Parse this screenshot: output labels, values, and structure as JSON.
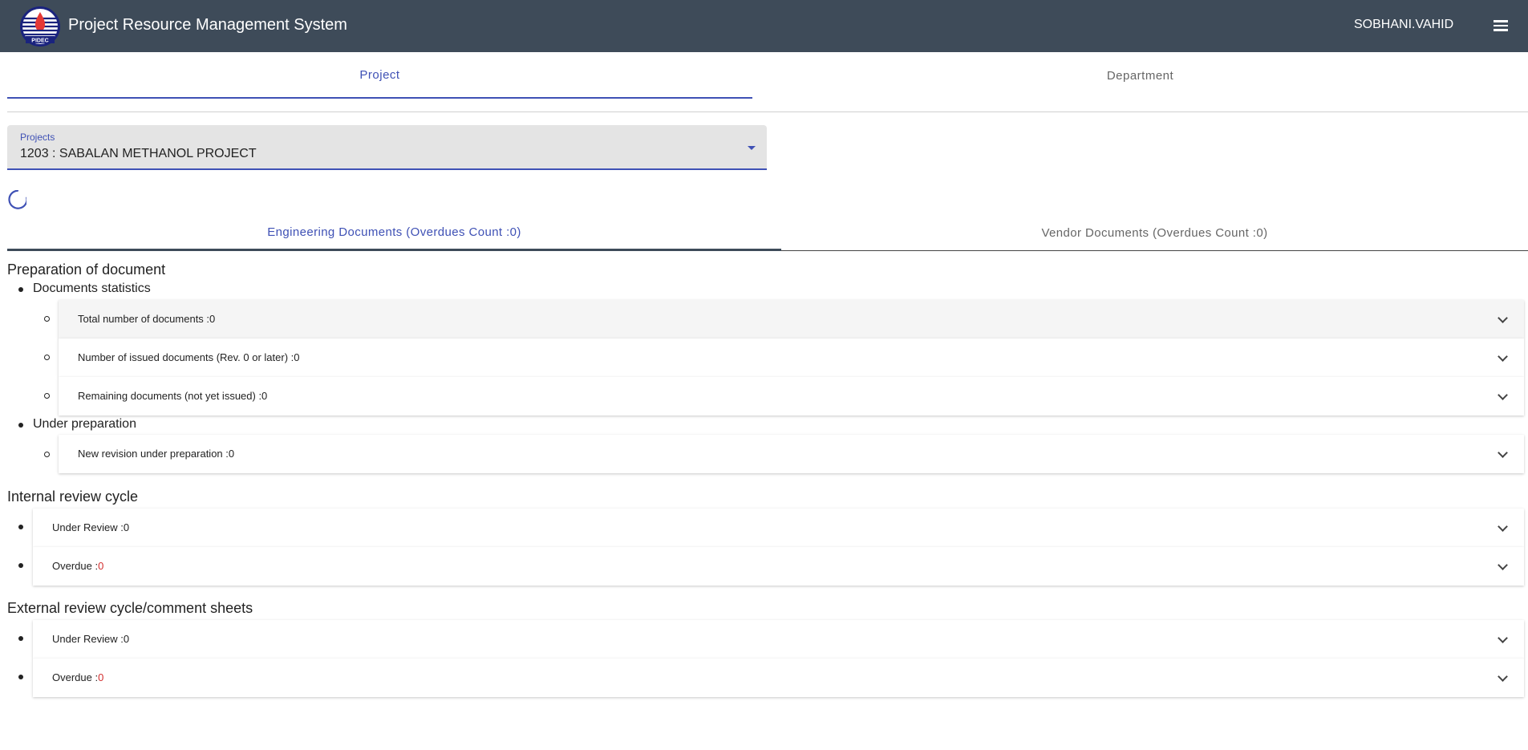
{
  "header": {
    "logo_text": "PIDEC",
    "title": "Project Resource Management System",
    "user": "SOBHANI.VAHID",
    "menu_icon": "hamburger-menu-icon"
  },
  "top_tabs": [
    {
      "label": "Project",
      "active": true
    },
    {
      "label": "Department",
      "active": false
    }
  ],
  "project_select": {
    "label": "Projects",
    "value": "1203 : SABALAN METHANOL PROJECT"
  },
  "doc_tabs": [
    {
      "label": "Engineering Documents (Overdues Count :0)",
      "active": true
    },
    {
      "label": "Vendor Documents (Overdues Count :0)",
      "active": false
    }
  ],
  "preparation": {
    "title": "Preparation of document",
    "statistics_label": "Documents statistics",
    "total": "Total number of documents :0",
    "issued": "Number of issued documents (Rev. 0 or later) :0",
    "remaining": "Remaining documents (not yet issued) :0",
    "under_prep_label": "Under preparation",
    "new_revision": "New revision under preparation :0"
  },
  "internal": {
    "title": "Internal review cycle",
    "under_review": "Under Review :0",
    "overdue_label": "Overdue :",
    "overdue_value": "0"
  },
  "external": {
    "title": "External review cycle/comment sheets",
    "under_review": "Under Review :0",
    "overdue_label": "Overdue :",
    "overdue_value": "0"
  },
  "colors": {
    "toolbar": "#3e4b59",
    "primary": "#3f51b5",
    "overdue": "#d32f2f"
  }
}
